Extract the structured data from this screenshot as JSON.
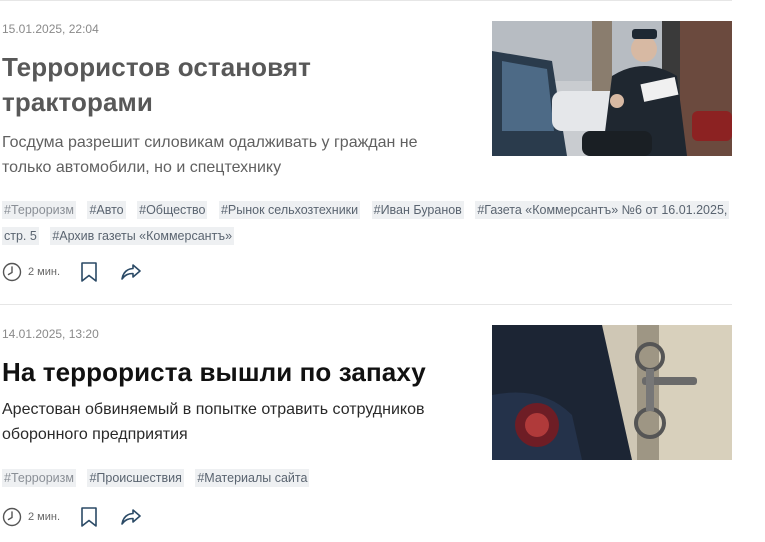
{
  "articles": [
    {
      "date": "15.01.2025, 22:04",
      "title_line1": "Террористов остановят",
      "title_line2": "тракторами",
      "lead_line1": "Госдума разрешит силовикам одалживать у граждан не",
      "lead_line2": "только автомобили, но и спецтехнику",
      "image": "police-officer-with-document-photo",
      "tags": [
        "#Терроризм",
        "#Авто",
        "#Общество",
        "#Рынок сельхозтехники",
        "#Иван Буранов",
        "#Газета «Коммерсантъ» №6 от 16.01.2025, стр. 5",
        "#Архив газеты «Коммерсантъ»"
      ],
      "read_time": "2 мин."
    },
    {
      "date": "14.01.2025, 13:20",
      "title_line1": "На террориста вышли по запаху",
      "lead_line1": "Арестован обвиняемый в попытке отравить сотрудников",
      "lead_line2": "оборонного предприятия",
      "image": "handcuffs-police-uniform-photo",
      "tags": [
        "#Терроризм",
        "#Происшествия",
        "#Материалы сайта"
      ],
      "read_time": "2 мин."
    }
  ],
  "icons": {
    "clock": "clock-icon",
    "bookmark": "bookmark-icon",
    "share": "share-icon"
  },
  "colors": {
    "tag_bg": "#eef0f2",
    "icon_blue": "#2b4a66",
    "meta_gray": "#666666"
  }
}
